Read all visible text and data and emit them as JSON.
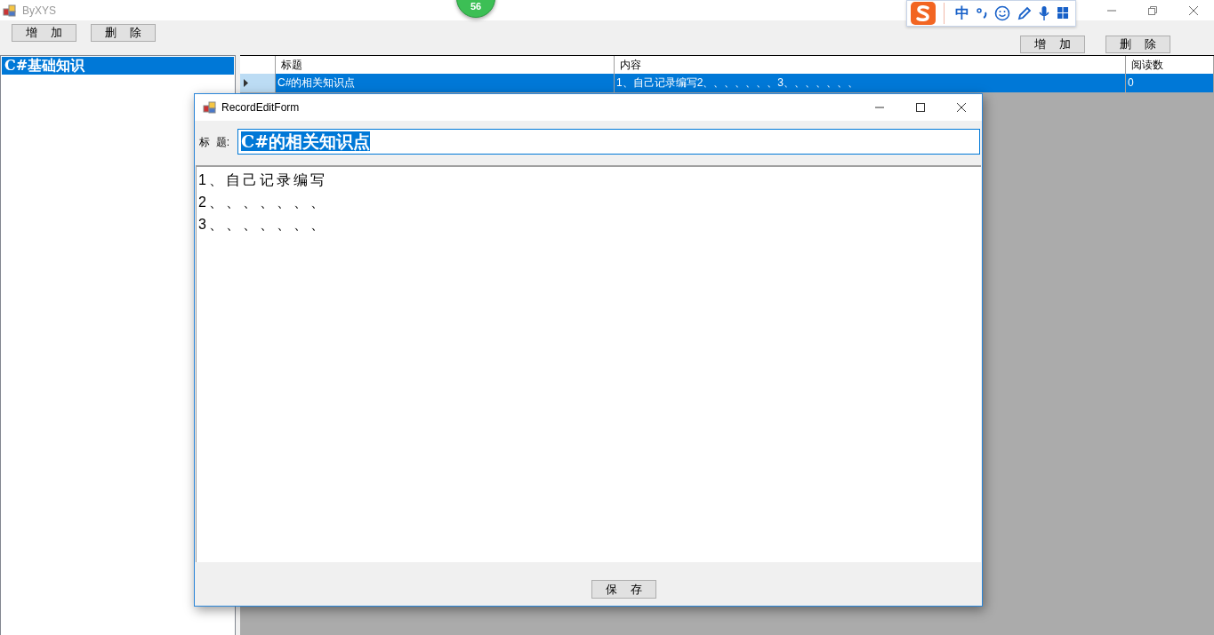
{
  "main_window": {
    "title": "ByXYS",
    "left_buttons": [
      "增    加",
      "删    除"
    ],
    "right_buttons": [
      "增    加",
      "删    除"
    ]
  },
  "tree": {
    "items": [
      {
        "label": "C#基础知识",
        "selected": true
      }
    ]
  },
  "grid": {
    "columns": [
      "标题",
      "内容",
      "阅读数"
    ],
    "rows": [
      {
        "cells": [
          "C#的相关知识点",
          "1、自己记录编写2、、、、、、、3、、、、、、、",
          "0"
        ],
        "selected": true,
        "current": true
      }
    ]
  },
  "badge": {
    "count": "56"
  },
  "ime_toolbar": {
    "mode": "中"
  },
  "dialog": {
    "title": "RecordEditForm",
    "title_label": "标  题:",
    "title_value": "C#的相关知识点",
    "title_value_selected": true,
    "content_lines": [
      "1、自己记录编写",
      "2、、、、、、、",
      "3、、、、、、、"
    ],
    "save_button": "保    存"
  }
}
